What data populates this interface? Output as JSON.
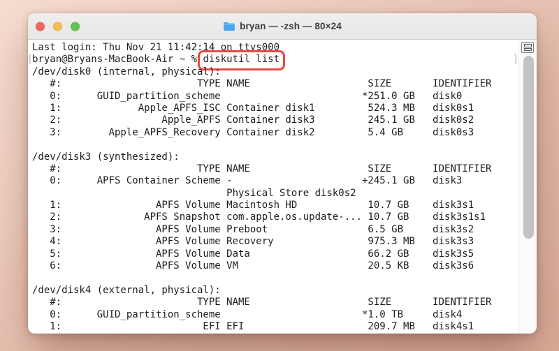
{
  "window": {
    "title": "bryan — -zsh — 80×24",
    "controls": {
      "close_color": "#ee6a5e",
      "minimize_color": "#f5bf4e",
      "zoom_color": "#61c454"
    }
  },
  "terminal": {
    "login_line": "Last login: Thu Nov 21 11:42:14 on ttys000",
    "prompt": "bryan@Bryans-MacBook-Air ~ % ",
    "command": "diskutil list",
    "mark_open": "[",
    "mark_close": "]",
    "output": [
      "/dev/disk0 (internal, physical):",
      "   #:                       TYPE NAME                    SIZE       IDENTIFIER",
      "   0:      GUID_partition_scheme                        *251.0 GB   disk0",
      "   1:             Apple_APFS_ISC Container disk1         524.3 MB   disk0s1",
      "   2:                 Apple_APFS Container disk3         245.1 GB   disk0s2",
      "   3:        Apple_APFS_Recovery Container disk2         5.4 GB     disk0s3",
      "",
      "/dev/disk3 (synthesized):",
      "   #:                       TYPE NAME                    SIZE       IDENTIFIER",
      "   0:      APFS Container Scheme -                      +245.1 GB   disk3",
      "                                 Physical Store disk0s2",
      "   1:                APFS Volume Macintosh HD            10.7 GB    disk3s1",
      "   2:              APFS Snapshot com.apple.os.update-... 10.7 GB    disk3s1s1",
      "   3:                APFS Volume Preboot                 6.5 GB     disk3s2",
      "   4:                APFS Volume Recovery                975.3 MB   disk3s3",
      "   5:                APFS Volume Data                    66.2 GB    disk3s5",
      "   6:                APFS Volume VM                      20.5 KB    disk3s6",
      "",
      "/dev/disk4 (external, physical):",
      "   #:                       TYPE NAME                    SIZE       IDENTIFIER",
      "   0:      GUID_partition_scheme                        *1.0 TB     disk4",
      "   1:                        EFI EFI                     209.7 MB   disk4s1"
    ]
  },
  "annotation": {
    "box_color": "#ee4742"
  },
  "colors": {
    "desktop_top": "#f6ddd1",
    "desktop_bottom": "#d7a996",
    "titlebar": "#eceae9",
    "terminal_background": "#ffffff",
    "terminal_text": "#1d1d1f",
    "shell_marks": "#b9b9b9",
    "folder_icon_blue": "#47a7f0"
  }
}
